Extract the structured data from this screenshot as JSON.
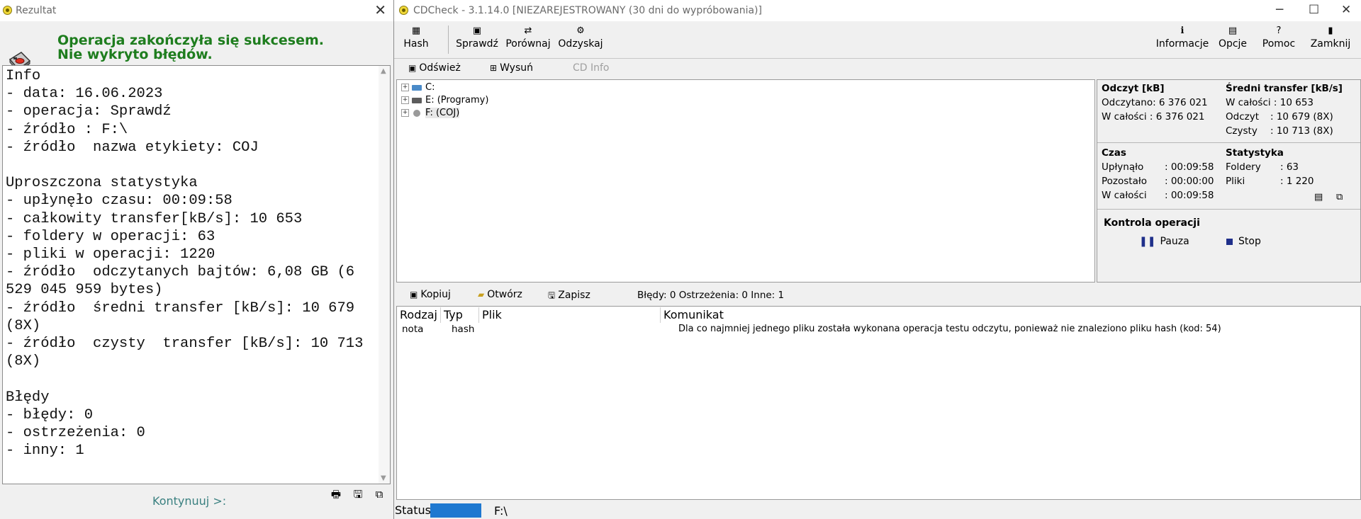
{
  "result_window": {
    "title": "Rezultat",
    "message_line1": "Operacja zakończyła się sukcesem.",
    "message_line2": "Nie wykryto błędów.",
    "report": "Info\n- data: 16.06.2023\n- operacja: Sprawdź\n- źródło : F:\\\n- źródło  nazwa etykiety: COJ\n\nUproszczona statystyka\n- upłynęło czasu: 00:09:58\n- całkowity transfer[kB/s]: 10 653\n- foldery w operacji: 63\n- pliki w operacji: 1220\n- źródło  odczytanych bajtów: 6,08 GB (6 529 045 959 bytes)\n- źródło  średni transfer [kB/s]: 10 679 (8X)\n- źródło  czysty  transfer [kB/s]: 10 713 (8X)\n\nBłędy\n- błędy: 0\n- ostrzeżenia: 0\n- inny: 1",
    "continue_label": "Kontynuuj >:",
    "close_glyph": "✕",
    "icons": [
      "disk-check-icon",
      "print-icon",
      "save-icon",
      "copy-icon"
    ]
  },
  "app": {
    "title": "CDCheck - 3.1.14.0 [NIEZAREJESTROWANY (30 dni do wypróbowania)]",
    "window_buttons": {
      "minimize": "─",
      "maximize": "☐",
      "close": "✕"
    },
    "toolbar": {
      "hash": "Hash",
      "check": "Sprawdź",
      "compare": "Porównaj",
      "recover": "Odzyskaj",
      "info": "Informacje",
      "options": "Opcje",
      "help": "Pomoc",
      "close": "Zamknij"
    },
    "subtoolbar": {
      "refresh": "Odśwież",
      "eject": "Wysuń",
      "cdinfo": "CD Info"
    },
    "tree": [
      {
        "label": "C:",
        "icon": "network-drive-icon"
      },
      {
        "label": "E: (Programy)",
        "icon": "hard-drive-icon"
      },
      {
        "label": "F: (COJ)",
        "icon": "cd-drive-icon"
      }
    ],
    "stats": {
      "read_title": "Odczyt [kB]",
      "read_done": "Odczytano: 6 376 021",
      "read_total": "W całości : 6 376 021",
      "avg_title": "Średni transfer [kB/s]",
      "avg_total": "W całości : 10 653",
      "avg_read_label": "Odczyt",
      "avg_read_value": ": 10 679 (8X)",
      "avg_clean_label": "Czysty",
      "avg_clean_value": ": 10 713 (8X)",
      "time_title": "Czas",
      "elapsed_label": "Upłynąło",
      "elapsed_value": ": 00:09:58",
      "remaining_label": "Pozostało",
      "remaining_value": ": 00:00:00",
      "total_label": "W całości",
      "total_value": ": 00:09:58",
      "statistics_title": "Statystyka",
      "folders_label": "Foldery",
      "folders_value": ": 63",
      "files_label": "Pliki",
      "files_value": ": 1 220",
      "control_title": "Kontrola operacji",
      "pause": "Pauza",
      "stop": "Stop"
    },
    "messages_bar": {
      "copy": "Kopiuj",
      "open": "Otwórz",
      "save": "Zapisz",
      "summary": "Błędy: 0 Ostrzeżenia: 0 Inne: 1"
    },
    "messages": {
      "columns": [
        "Rodzaj",
        "Typ",
        "Plik",
        "Komunikat"
      ],
      "rows": [
        {
          "type": "nota",
          "kind": "hash",
          "file": "",
          "message": "Dla co najmniej jednego pliku została wykonana operacja testu odczytu, ponieważ nie znaleziono pliku hash (kod: 54)"
        }
      ]
    },
    "status": {
      "label": "Status:",
      "path": "F:\\"
    }
  }
}
